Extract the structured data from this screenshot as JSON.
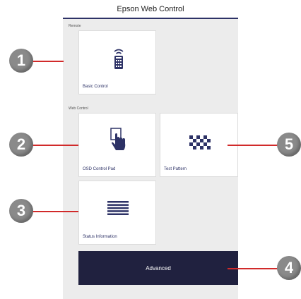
{
  "header": {
    "title": "Epson Web Control"
  },
  "sections": {
    "remote": "Remote",
    "web_control": "Web Control"
  },
  "tiles": {
    "basic_control": "Basic Control",
    "osd_control_pad": "OSD Control Pad",
    "test_pattern": "Test Pattern",
    "status_information": "Status Information",
    "advanced": "Advanced"
  },
  "callouts": [
    "1",
    "2",
    "3",
    "4",
    "5"
  ],
  "icons": {
    "basic_control": "remote-control-icon",
    "osd_control_pad": "touch-hand-icon",
    "test_pattern": "checkerboard-icon",
    "status_information": "list-lines-icon"
  },
  "colors": {
    "accent": "#2d3266",
    "advanced_bg": "#20213f",
    "callout_line": "#d12a2a",
    "callout_circle": "#8a8a8a",
    "panel_bg": "#ececec"
  }
}
